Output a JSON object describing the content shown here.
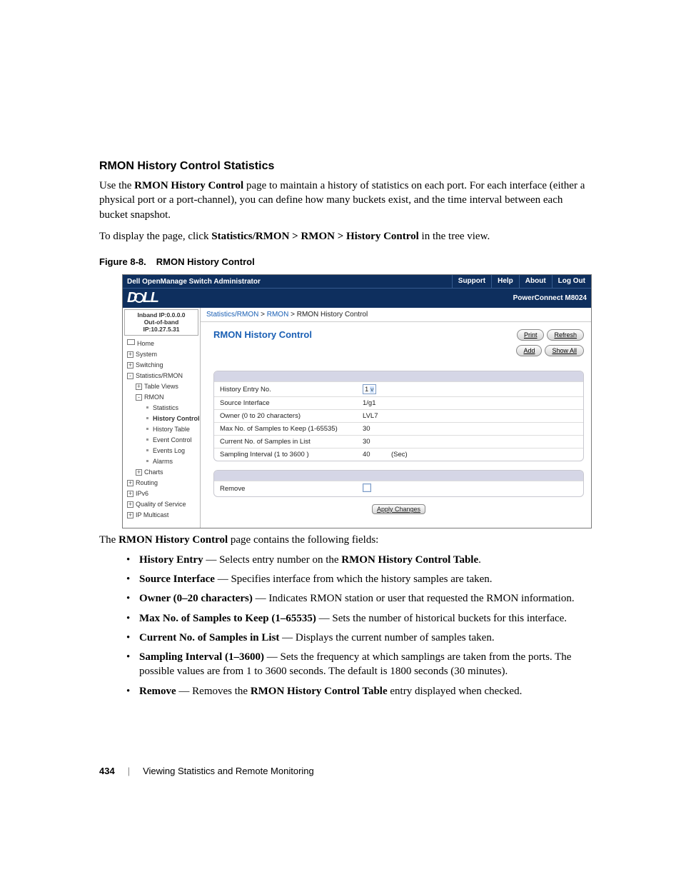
{
  "section": {
    "title": "RMON History Control Statistics",
    "p1_a": "Use the ",
    "p1_b": "RMON History Control",
    "p1_c": " page to maintain a history of statistics on each port. For each interface (either a physical port or a port-channel), you can define how many buckets exist, and the time interval between each bucket snapshot.",
    "p2_a": "To display the page, click ",
    "p2_b": "Statistics/RMON > RMON > History Control",
    "p2_c": " in the tree view.",
    "figcap_a": "Figure 8-8.",
    "figcap_b": "RMON History Control"
  },
  "fig": {
    "topbar_title": "Dell OpenManage Switch Administrator",
    "tabs": {
      "support": "Support",
      "help": "Help",
      "about": "About",
      "logout": "Log Out"
    },
    "model": "PowerConnect M8024",
    "ip": {
      "inband": "Inband IP:0.0.0.0",
      "outband": "Out-of-band IP:10.27.5.31"
    },
    "tree": {
      "home": "Home",
      "system": "System",
      "switching": "Switching",
      "stats": "Statistics/RMON",
      "tableviews": "Table Views",
      "rmon": "RMON",
      "statistics": "Statistics",
      "history_control": "History Control",
      "history_table": "History Table",
      "event_control": "Event Control",
      "events_log": "Events Log",
      "alarms": "Alarms",
      "charts": "Charts",
      "routing": "Routing",
      "ipv6": "IPv6",
      "qos": "Quality of Service",
      "ipmulticast": "IP Multicast"
    },
    "crumb": {
      "a": "Statistics/RMON",
      "b": "RMON",
      "c": "RMON History Control",
      "sep": " > "
    },
    "panel_title": "RMON History Control",
    "buttons": {
      "print": "Print",
      "refresh": "Refresh",
      "add": "Add",
      "showall": "Show All"
    },
    "rows": {
      "r1": {
        "label": "History Entry No.",
        "value": "1"
      },
      "r2": {
        "label": "Source Interface",
        "value": "1/g1"
      },
      "r3": {
        "label": "Owner (0 to 20 characters)",
        "value": "LVL7"
      },
      "r4": {
        "label": "Max No. of Samples to Keep (1-65535)",
        "value": "30"
      },
      "r5": {
        "label": "Current No. of Samples in List",
        "value": "30"
      },
      "r6": {
        "label": "Sampling Interval (1 to 3600 )",
        "value": "40",
        "unit": "(Sec)"
      },
      "remove": "Remove"
    },
    "apply": "Apply Changes"
  },
  "after": {
    "lead_a": "The ",
    "lead_b": "RMON History Control",
    "lead_c": " page contains the following fields:",
    "items": {
      "i1": {
        "b": "History Entry",
        "t1": " — Selects entry number on the ",
        "b2": "RMON History Control Table",
        "t2": "."
      },
      "i2": {
        "b": "Source Interface",
        "t": " — Specifies interface from which the history samples are taken."
      },
      "i3": {
        "b": "Owner (0–20 characters)",
        "t": " — Indicates RMON station or user that requested the RMON information."
      },
      "i4": {
        "b": "Max No. of Samples to Keep (1–65535)",
        "t": " — Sets the number of historical buckets for this interface."
      },
      "i5": {
        "b": "Current No. of Samples in List",
        "t": " — Displays the current number of samples taken."
      },
      "i6": {
        "b": "Sampling Interval (1–3600)",
        "t": " — Sets the frequency at which samplings are taken from the ports. The possible values are from 1 to 3600 seconds. The default is 1800 seconds (30 minutes)."
      },
      "i7": {
        "b": "Remove",
        "t1": " — Removes the ",
        "b2": "RMON History Control Table",
        "t2": " entry displayed when checked."
      }
    }
  },
  "footer": {
    "page": "434",
    "sep": "|",
    "chapter": "Viewing Statistics and Remote Monitoring"
  }
}
